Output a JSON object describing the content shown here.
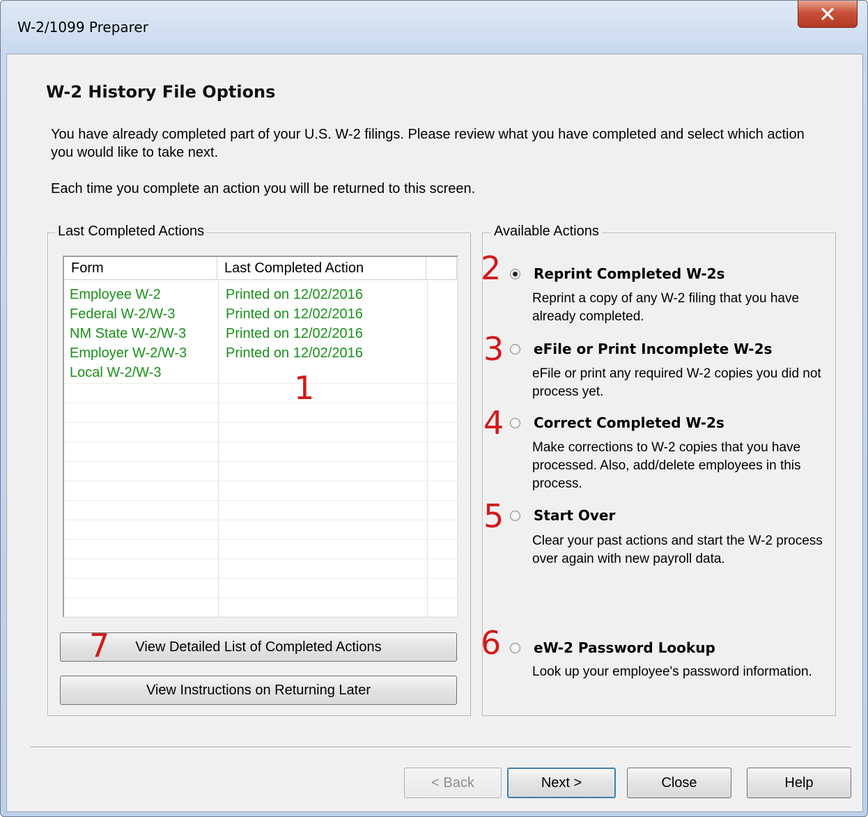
{
  "window": {
    "title": "W-2/1099 Preparer"
  },
  "page": {
    "heading": "W-2 History File Options",
    "intro": "You have already completed part of your U.S. W-2 filings. Please review what you have completed and select which action you would like to take next.",
    "intro2": "Each time you complete an action you will be returned to this screen."
  },
  "last_completed": {
    "legend": "Last Completed Actions",
    "columns": [
      "Form",
      "Last Completed Action"
    ],
    "rows": [
      {
        "form": "Employee W-2",
        "action": "Printed on 12/02/2016"
      },
      {
        "form": "Federal W-2/W-3",
        "action": "Printed on 12/02/2016"
      },
      {
        "form": "NM State W-2/W-3",
        "action": "Printed on 12/02/2016"
      },
      {
        "form": "Employer W-2/W-3",
        "action": "Printed on 12/02/2016"
      },
      {
        "form": "Local W-2/W-3",
        "action": ""
      }
    ],
    "view_detailed_label": "View Detailed List of Completed Actions",
    "view_instructions_label": "View Instructions on Returning Later"
  },
  "available": {
    "legend": "Available Actions",
    "options": [
      {
        "title": "Reprint Completed W-2s",
        "desc": "Reprint a copy of any W-2 filing that you have already completed.",
        "selected": true
      },
      {
        "title": "eFile or Print Incomplete W-2s",
        "desc": "eFile or print any required W-2 copies you did not process yet.",
        "selected": false
      },
      {
        "title": "Correct Completed W-2s",
        "desc": "Make corrections to W-2 copies that you have processed. Also, add/delete employees in this process.",
        "selected": false
      },
      {
        "title": "Start Over",
        "desc": "Clear your past actions and start the W-2 process over again with new payroll data.",
        "selected": false
      },
      {
        "title": "eW-2 Password Lookup",
        "desc": "Look up your employee's password information.",
        "selected": false
      }
    ]
  },
  "annotations": {
    "n1": "1",
    "n2": "2",
    "n3": "3",
    "n4": "4",
    "n5": "5",
    "n6": "6",
    "n7": "7",
    "color": "#d11a1a"
  },
  "footer": {
    "back_label": "< Back",
    "next_label": "Next >",
    "close_label": "Close",
    "help_label": "Help"
  },
  "colors": {
    "completed_text": "#1a8f1a",
    "close_button": "#c9503a"
  }
}
